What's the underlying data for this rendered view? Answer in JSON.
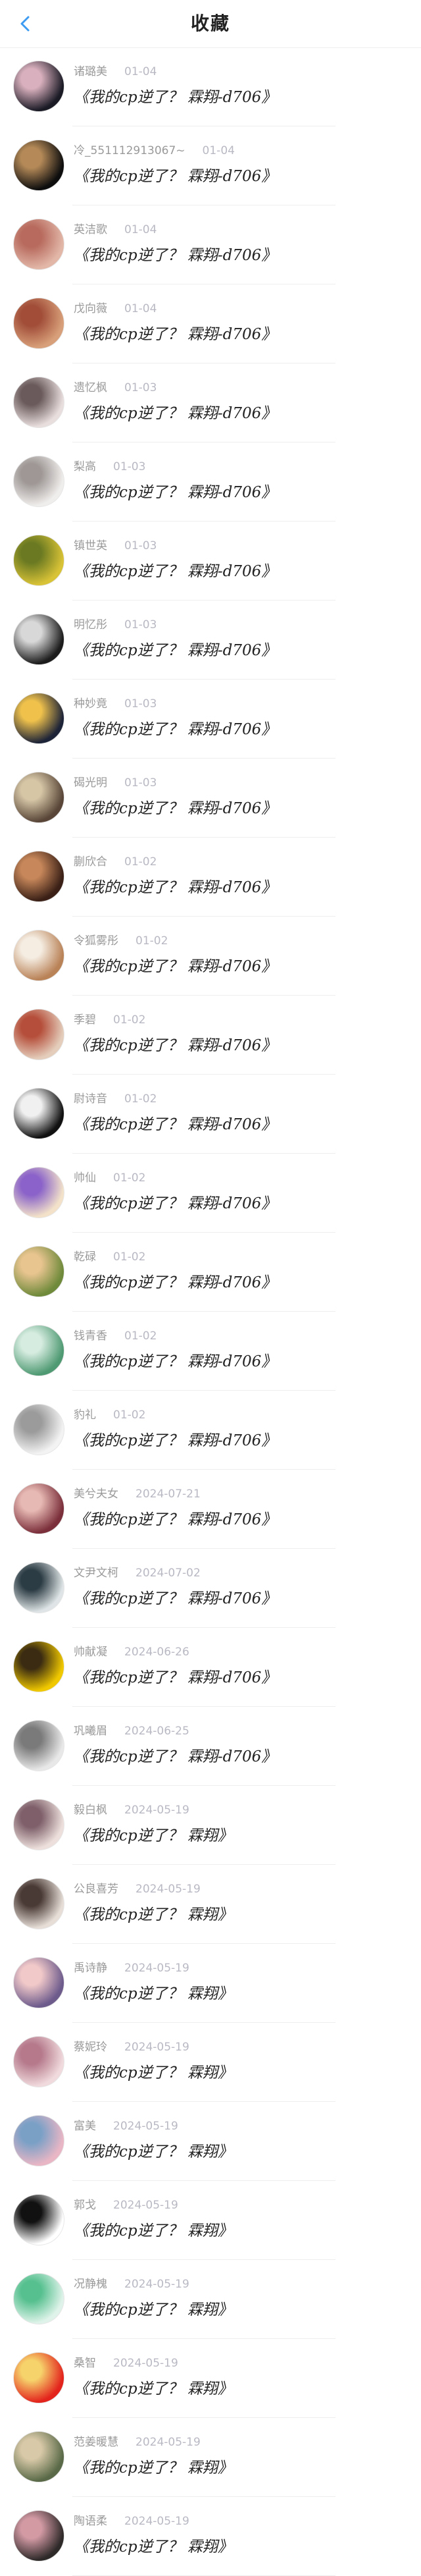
{
  "header": {
    "title": "收藏",
    "back_icon": "chevron-left-icon",
    "accent": "#3d9bf2"
  },
  "items": [
    {
      "name": "诸璐美",
      "date": "01-04",
      "title": "《我的cp逆了？ 霖翔-d706》",
      "avatar_colors": [
        "#1b1b26",
        "#d9b0bd"
      ]
    },
    {
      "name": "冷_551112913067~",
      "date": "01-04",
      "title": "《我的cp逆了？ 霖翔-d706》",
      "avatar_colors": [
        "#0e0e0e",
        "#b58a58"
      ]
    },
    {
      "name": "英洁歌",
      "date": "01-04",
      "title": "《我的cp逆了？ 霖翔-d706》",
      "avatar_colors": [
        "#e2b7a8",
        "#b76a5d"
      ]
    },
    {
      "name": "戊向薇",
      "date": "01-04",
      "title": "《我的cp逆了？ 霖翔-d706》",
      "avatar_colors": [
        "#d8a07a",
        "#a14d38"
      ]
    },
    {
      "name": "遗忆枫",
      "date": "01-03",
      "title": "《我的cp逆了？ 霖翔-d706》",
      "avatar_colors": [
        "#e9dede",
        "#6a5a5c"
      ]
    },
    {
      "name": "梨高",
      "date": "01-03",
      "title": "《我的cp逆了？ 霖翔-d706》",
      "avatar_colors": [
        "#f0eeec",
        "#9e9796"
      ]
    },
    {
      "name": "镇世英",
      "date": "01-03",
      "title": "《我的cp逆了？ 霖翔-d706》",
      "avatar_colors": [
        "#d8c236",
        "#6b7a22"
      ]
    },
    {
      "name": "明忆彤",
      "date": "01-03",
      "title": "《我的cp逆了？ 霖翔-d706》",
      "avatar_colors": [
        "#1c1c1c",
        "#d8d8d8"
      ]
    },
    {
      "name": "种妙竟",
      "date": "01-03",
      "title": "《我的cp逆了？ 霖翔-d706》",
      "avatar_colors": [
        "#1e2438",
        "#f0c24c"
      ]
    },
    {
      "name": "碣光明",
      "date": "01-03",
      "title": "《我的cp逆了？ 霖翔-d706》",
      "avatar_colors": [
        "#594638",
        "#d6c6a6"
      ]
    },
    {
      "name": "蒯欣合",
      "date": "01-02",
      "title": "《我的cp逆了？ 霖翔-d706》",
      "avatar_colors": [
        "#3a2016",
        "#c7875a"
      ]
    },
    {
      "name": "令狐雾彤",
      "date": "01-02",
      "title": "《我的cp逆了？ 霖翔-d706》",
      "avatar_colors": [
        "#b98257",
        "#f5ede2"
      ]
    },
    {
      "name": "季碧",
      "date": "01-02",
      "title": "《我的cp逆了？ 霖翔-d706》",
      "avatar_colors": [
        "#e4cdbb",
        "#b54f3b"
      ]
    },
    {
      "name": "尉诗音",
      "date": "01-02",
      "title": "《我的cp逆了？ 霖翔-d706》",
      "avatar_colors": [
        "#111111",
        "#f0f0f0"
      ]
    },
    {
      "name": "帅仙",
      "date": "01-02",
      "title": "《我的cp逆了？ 霖翔-d706》",
      "avatar_colors": [
        "#f3e2c9",
        "#8a62c9"
      ]
    },
    {
      "name": "乾碌",
      "date": "01-02",
      "title": "《我的cp逆了？ 霖翔-d706》",
      "avatar_colors": [
        "#6f8a3a",
        "#e8c48f"
      ]
    },
    {
      "name": "钱青香",
      "date": "01-02",
      "title": "《我的cp逆了？ 霖翔-d706》",
      "avatar_colors": [
        "#4f9a73",
        "#d6ece0"
      ]
    },
    {
      "name": "豹礼",
      "date": "01-02",
      "title": "《我的cp逆了？ 霖翔-d706》",
      "avatar_colors": [
        "#f3f3f3",
        "#9b9b9b"
      ]
    },
    {
      "name": "美兮夫女",
      "date": "2024-07-21",
      "title": "《我的cp逆了？ 霖翔-d706》",
      "avatar_colors": [
        "#7b2f3a",
        "#e7b9b4"
      ]
    },
    {
      "name": "文尹文柯",
      "date": "2024-07-02",
      "title": "《我的cp逆了？ 霖翔-d706》",
      "avatar_colors": [
        "#dfe5e6",
        "#2c3c44"
      ]
    },
    {
      "name": "帅献凝",
      "date": "2024-06-26",
      "title": "《我的cp逆了？ 霖翔-d706》",
      "avatar_colors": [
        "#f0c800",
        "#3a2b12"
      ]
    },
    {
      "name": "巩曦眉",
      "date": "2024-06-25",
      "title": "《我的cp逆了？ 霖翔-d706》",
      "avatar_colors": [
        "#e8e8e8",
        "#7a7a7a"
      ]
    },
    {
      "name": "毅白枫",
      "date": "2024-05-19",
      "title": "《我的cp逆了？ 霖翔》",
      "avatar_colors": [
        "#ede0dc",
        "#7e5f6a"
      ]
    },
    {
      "name": "公良喜芳",
      "date": "2024-05-19",
      "title": "《我的cp逆了？ 霖翔》",
      "avatar_colors": [
        "#e7ded8",
        "#4a3a35"
      ]
    },
    {
      "name": "禹诗静",
      "date": "2024-05-19",
      "title": "《我的cp逆了？ 霖翔》",
      "avatar_colors": [
        "#6d5b8c",
        "#f1c9c9"
      ]
    },
    {
      "name": "蔡妮玲",
      "date": "2024-05-19",
      "title": "《我的cp逆了？ 霖翔》",
      "avatar_colors": [
        "#f0dadd",
        "#b5798b"
      ]
    },
    {
      "name": "富美",
      "date": "2024-05-19",
      "title": "《我的cp逆了？ 霖翔》",
      "avatar_colors": [
        "#e9b6c5",
        "#7aa0c6"
      ]
    },
    {
      "name": "郭戈",
      "date": "2024-05-19",
      "title": "《我的cp逆了？ 霖翔》",
      "avatar_colors": [
        "#ffffff",
        "#111111"
      ]
    },
    {
      "name": "况静槐",
      "date": "2024-05-19",
      "title": "《我的cp逆了？ 霖翔》",
      "avatar_colors": [
        "#dff3ea",
        "#56c08f"
      ]
    },
    {
      "name": "桑智",
      "date": "2024-05-19",
      "title": "《我的cp逆了？ 霖翔》",
      "avatar_colors": [
        "#e3241d",
        "#f6d36b"
      ]
    },
    {
      "name": "范姜暖慧",
      "date": "2024-05-19",
      "title": "《我的cp逆了？ 霖翔》",
      "avatar_colors": [
        "#5a6a48",
        "#d8c9a8"
      ]
    },
    {
      "name": "陶语柔",
      "date": "2024-05-19",
      "title": "《我的cp逆了？ 霖翔》",
      "avatar_colors": [
        "#2f2a2a",
        "#d39aa4"
      ]
    }
  ]
}
